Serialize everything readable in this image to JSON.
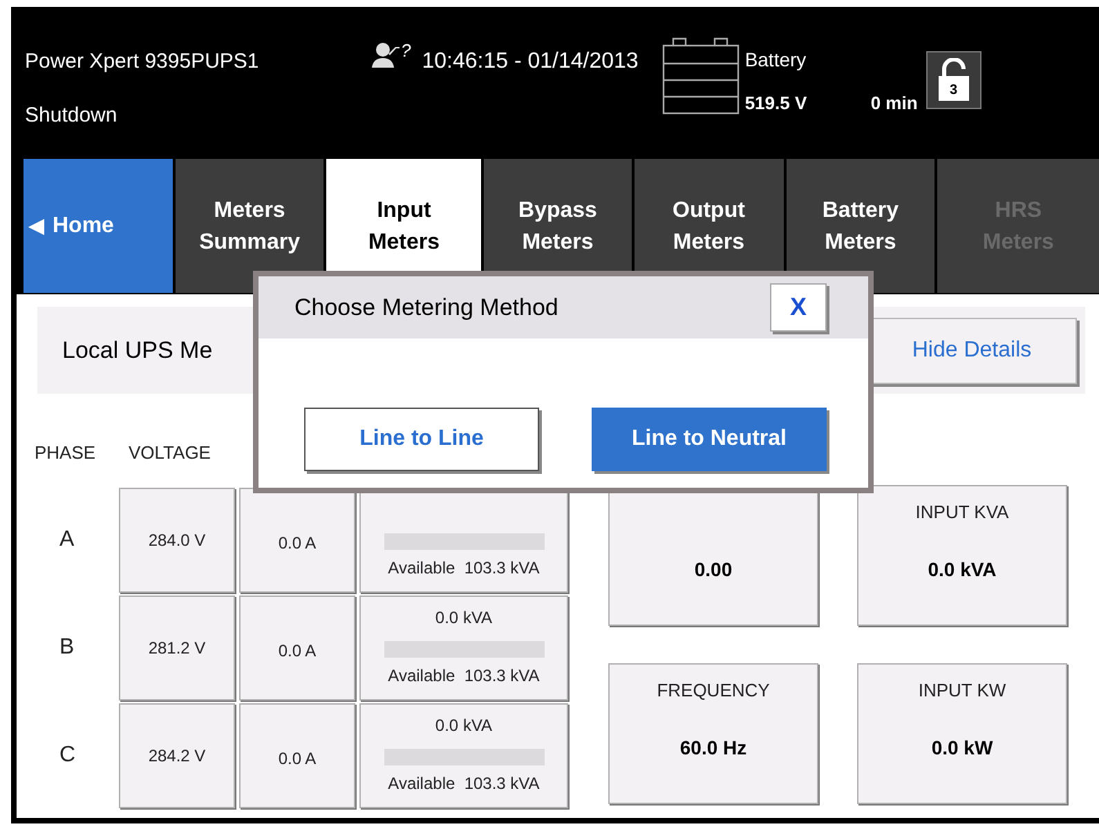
{
  "header": {
    "device": "Power Xpert 9395PUPS1",
    "status": "Shutdown",
    "help_mark": "?",
    "datetime": "10:46:15 - 01/14/2013",
    "battery": {
      "label": "Battery",
      "voltage": "519.5 V",
      "runtime": "0 min"
    },
    "lock_level": "3"
  },
  "tabs": [
    {
      "kind": "home",
      "arrow": "◀",
      "label": "Home",
      "selected": false,
      "disabled": false
    },
    {
      "kind": "page",
      "label": "Meters Summary",
      "selected": false,
      "disabled": false
    },
    {
      "kind": "page",
      "label": "Input Meters",
      "selected": true,
      "disabled": false
    },
    {
      "kind": "page",
      "label": "Bypass Meters",
      "selected": false,
      "disabled": false
    },
    {
      "kind": "page",
      "label": "Output Meters",
      "selected": false,
      "disabled": false
    },
    {
      "kind": "page",
      "label": "Battery Meters",
      "selected": false,
      "disabled": false
    },
    {
      "kind": "page",
      "label": "HRS Meters",
      "selected": false,
      "disabled": true
    }
  ],
  "section": {
    "title": "Local UPS Me",
    "toggle_button": "Hide Details"
  },
  "table": {
    "columns": [
      "PHASE",
      "VOLTAGE"
    ],
    "rows": [
      {
        "phase": "A",
        "voltage": "284.0 V",
        "current": "0.0 A",
        "available": "Available  103.3 kVA"
      },
      {
        "phase": "B",
        "voltage": "281.2 V",
        "current": "0.0 A",
        "power": "0.0 kVA",
        "available": "Available  103.3 kVA"
      },
      {
        "phase": "C",
        "voltage": "284.2 V",
        "current": "0.0 A",
        "power": "0.0 kVA",
        "available": "Available  103.3 kVA"
      }
    ]
  },
  "summary": {
    "rows": [
      {
        "boxes": [
          {
            "value": "0.00"
          },
          {
            "label": "INPUT KVA",
            "value": "0.0 kVA"
          }
        ]
      },
      {
        "boxes": [
          {
            "label": "FREQUENCY",
            "value": "60.0 Hz"
          },
          {
            "label": "INPUT KW",
            "value": "0.0 kW"
          }
        ]
      }
    ]
  },
  "dialog": {
    "title": "Choose Metering Method",
    "close": "X",
    "options": [
      {
        "label": "Line to Line",
        "selected": false
      },
      {
        "label": "Line to Neutral",
        "selected": true
      }
    ]
  }
}
